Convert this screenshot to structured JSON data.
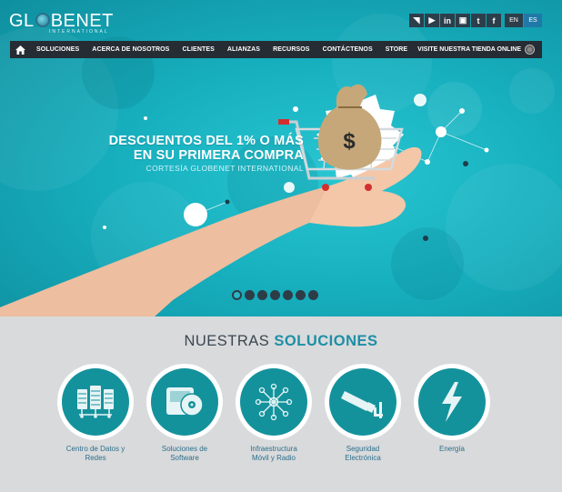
{
  "brand": {
    "logo_text_left": "GL",
    "logo_text_right": "BENET",
    "logo_sub": "INTERNATIONAL"
  },
  "social": [
    {
      "icon": "rss-icon",
      "glyph": "◥"
    },
    {
      "icon": "youtube-icon",
      "glyph": "▶"
    },
    {
      "icon": "linkedin-icon",
      "glyph": "in"
    },
    {
      "icon": "instagram-icon",
      "glyph": "▣"
    },
    {
      "icon": "twitter-icon",
      "glyph": "t"
    },
    {
      "icon": "facebook-icon",
      "glyph": "f"
    }
  ],
  "lang": {
    "en": "EN",
    "es": "ES",
    "active": "ES"
  },
  "nav": {
    "items": [
      "SOLUCIONES",
      "ACERCA DE NOSOTROS",
      "CLIENTES",
      "ALIANZAS",
      "RECURSOS",
      "CONTÁCTENOS",
      "STORE"
    ],
    "store_link": "VISITE NUESTRA TIENDA ONLINE"
  },
  "hero": {
    "line1": "DESCUENTOS DEL  1% O MÁS",
    "line2": "EN SU PRIMERA COMPRA",
    "line3": "CORTESÍA GLOBENET INTERNATIONAL",
    "slides": 7,
    "active_slide": 1
  },
  "solutions": {
    "title_plain": "NUESTRAS ",
    "title_highlight": "SOLUCIONES",
    "items": [
      {
        "icon": "server-rack-icon",
        "line1": "Centro de Datos y",
        "line2": "Redes"
      },
      {
        "icon": "software-disc-icon",
        "line1": "Soluciones de",
        "line2": "Software"
      },
      {
        "icon": "network-hub-icon",
        "line1": "Infraestructura",
        "line2": "Móvil y Radio"
      },
      {
        "icon": "security-camera-icon",
        "line1": "Seguridad",
        "line2": "Electrónica"
      },
      {
        "icon": "lightning-bolt-icon",
        "line1": "Energía",
        "line2": ""
      }
    ]
  },
  "colors": {
    "hero": "#17b0bf",
    "nav": "#262c33",
    "solutions_bg": "#d9dadc",
    "icon_circle": "#14929c",
    "accent": "#1c8fa5"
  }
}
